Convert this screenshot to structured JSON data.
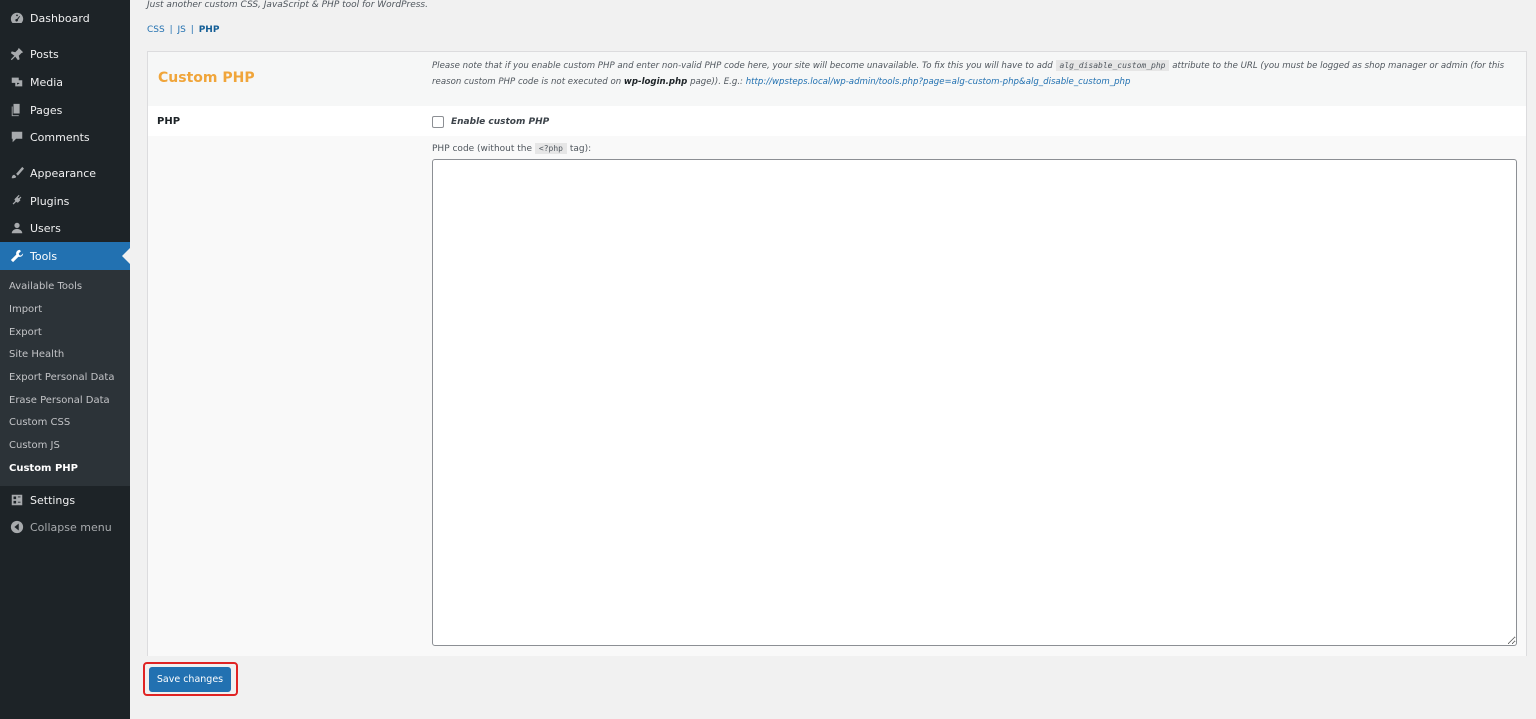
{
  "sidebar": {
    "menu": [
      {
        "label": "Dashboard",
        "icon": "dashboard-icon"
      },
      {
        "label": "Posts",
        "icon": "pin-icon"
      },
      {
        "label": "Media",
        "icon": "media-icon"
      },
      {
        "label": "Pages",
        "icon": "pages-icon"
      },
      {
        "label": "Comments",
        "icon": "comment-icon"
      },
      {
        "label": "Appearance",
        "icon": "brush-icon"
      },
      {
        "label": "Plugins",
        "icon": "plug-icon"
      },
      {
        "label": "Users",
        "icon": "user-icon"
      },
      {
        "label": "Tools",
        "icon": "wrench-icon",
        "active": true
      },
      {
        "label": "Settings",
        "icon": "settings-icon"
      },
      {
        "label": "Collapse menu",
        "icon": "collapse-icon"
      }
    ],
    "submenu": [
      {
        "label": "Available Tools"
      },
      {
        "label": "Import"
      },
      {
        "label": "Export"
      },
      {
        "label": "Site Health"
      },
      {
        "label": "Export Personal Data"
      },
      {
        "label": "Erase Personal Data"
      },
      {
        "label": "Custom CSS"
      },
      {
        "label": "Custom JS"
      },
      {
        "label": "Custom PHP",
        "current": true
      }
    ]
  },
  "header": {
    "tagline": "Just another custom CSS, JavaScript & PHP tool for WordPress.",
    "nav": {
      "css": "CSS",
      "js": "JS",
      "php": "PHP",
      "separator": "|"
    }
  },
  "panel": {
    "title": "Custom PHP",
    "note": {
      "part1": "Please note that if you enable custom PHP and enter non-valid PHP code here, your site will become unavailable. To fix this you will have to add ",
      "code": "alg_disable_custom_php",
      "part2": " attribute to the URL (you must be logged as shop manager or admin (for this reason custom PHP code is not executed on ",
      "bold": "wp-login.php",
      "part3": " page)). E.g.: ",
      "link": "http://wpsteps.local/wp-admin/tools.php?page=alg-custom-php&alg_disable_custom_php"
    },
    "row_label": "PHP",
    "checkbox_label": "Enable custom PHP",
    "code_label_prefix": "PHP code (without the ",
    "code_label_code": "<?php",
    "code_label_suffix": " tag):",
    "code_value": ""
  },
  "save_button": "Save changes",
  "colors": {
    "sidebar_bg": "#1d2327",
    "active_bg": "#2271b1",
    "title": "#f0a53a",
    "highlight": "#e02424"
  }
}
